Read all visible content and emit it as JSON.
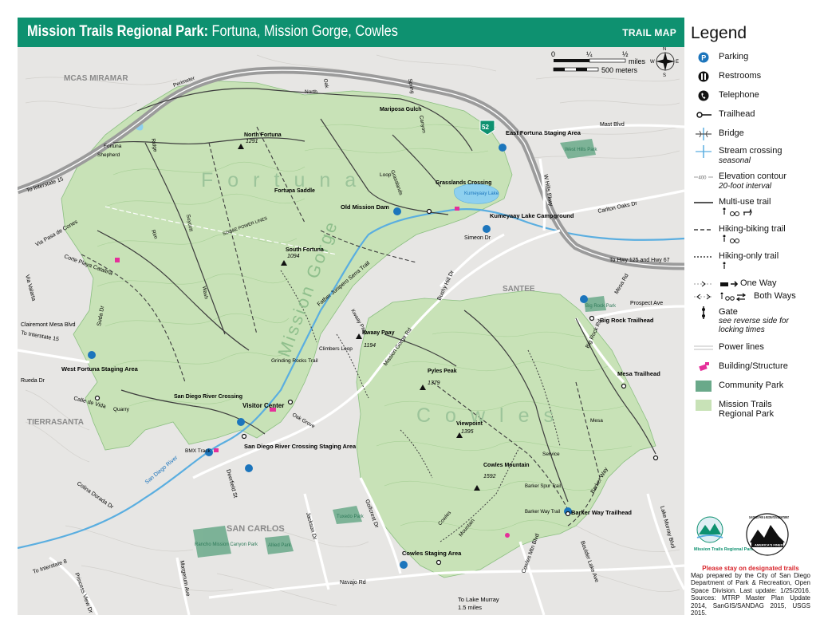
{
  "header": {
    "title_main": "Mission Trails Regional Park:",
    "title_sub": "Fortuna, Mission Gorge, Cowles",
    "map_type": "TRAIL MAP"
  },
  "scale_bar": {
    "miles_ticks": [
      "0",
      "¼",
      "½"
    ],
    "miles_label": "miles",
    "meters_label": "500 meters"
  },
  "compass": {
    "n": "N",
    "e": "E",
    "s": "S",
    "w": "W"
  },
  "areas": {
    "fortuna": "Fortuna",
    "mission_gorge": "Mission Gorge",
    "cowles": "Cowles"
  },
  "neighborhoods": {
    "mcas_miramar": "MCAS MIRAMAR",
    "santee": "SANTEE",
    "tierrasanta": "TIERRASANTA",
    "san_carlos": "SAN CARLOS"
  },
  "peaks": [
    {
      "name": "North Fortuna",
      "elev": "1291"
    },
    {
      "name": "South Fortuna",
      "elev": "1094"
    },
    {
      "name": "Kwaay Paay",
      "elev": "1194"
    },
    {
      "name": "Pyles Peak",
      "elev": "1379"
    },
    {
      "name": "Viewpoint",
      "elev": "1395"
    },
    {
      "name": "Cowles Mountain",
      "elev": "1592"
    }
  ],
  "places": {
    "east_fortuna": "East Fortuna Staging Area",
    "kumeyaay_campground": "Kumeyaay Lake Campground",
    "old_mission_dam": "Old Mission Dam",
    "grasslands": "Grasslands Crossing",
    "fortuna_saddle": "Fortuna Saddle",
    "big_rock": "Big Rock Trailhead",
    "mesa_trailhead": "Mesa Trailhead",
    "west_fortuna": "West Fortuna Staging Area",
    "visitor_center": "Visitor Center",
    "sdr_crossing": "San Diego River Crossing",
    "sdr_staging": "San Diego River Crossing Staging Area",
    "grinding_rocks": "Grinding Rocks Trail",
    "climbers_loop": "Climbers Loop",
    "bmx": "BMX Track",
    "barker_way": "Barker Way Trailhead",
    "cowles_staging": "Cowles Staging Area",
    "kumeyaay_lake": "Kumeyaay Lake",
    "barker_spur": "Barker Spur Trail",
    "mariposa": "Mariposa Gulch"
  },
  "parks": {
    "west_hills": "West Hills Park",
    "big_rock_park": "Big Rock Park",
    "tuxedo": "Tuxedo Park",
    "rancho": "Rancho Mission Canyon Park",
    "allied": "Allied Park"
  },
  "roads": {
    "to_i15_top": "To Interstate 15",
    "to_hwy125": "To Hwy 125 and Hwy 67",
    "to_i15_left": "To Interstate 15",
    "to_i8": "To Interstate 8",
    "to_lake_murray": "To Lake Murray",
    "lake_murray_dist": "1.5 miles",
    "mast_blvd": "Mast Blvd",
    "carlton_oaks": "Carlton Oaks Dr",
    "w_hills": "W Hills Pkwy",
    "prospect": "Prospect Ave",
    "mesa_rd": "Mesa Rd",
    "big_rock_rd": "Big Rock Rd",
    "bushy_hill": "Bushy Hill Dr",
    "simeon": "Simeon Dr",
    "father_junipero": "Father Junipero Serra Trail",
    "mission_gorge_rd": "Mission Gorge Rd",
    "golfcrest": "Golfcrest Dr",
    "jackson": "Jackson Dr",
    "navajo": "Navajo Rd",
    "cowles_mtn_blvd": "Cowles Mtn Blvd",
    "boulder_lake": "Boulder Lake Ave",
    "lake_murray_blvd": "Lake Murray Blvd",
    "barker_way_rd": "Barker Way",
    "princess_view": "Princess View Dr",
    "margerum": "Margerum Ave",
    "deerfield": "Deerfield St",
    "colina_dorada": "Colina Dorada Dr",
    "rueda": "Rueda Dr",
    "clairemont": "Clairemont Mesa Blvd",
    "via_valarta": "Via Valarta",
    "corte_playa": "Corte Playa Catalina",
    "via_pasa": "Via Pasa de Cones",
    "calle_de_vida": "Calle de Vida",
    "suda": "Suda Dr",
    "sdr_label": "San Diego River",
    "hwy52": "52",
    "power_lines": "SDG&E POWER LINES"
  },
  "trail_names": [
    "Perimeter",
    "Trail",
    "North",
    "Fortuna",
    "Shepherd",
    "Ridge",
    "Canyon",
    "Oak",
    "Spring",
    "Loop",
    "Wash",
    "Suycott",
    "Rim",
    "Quarry",
    "Oak Grove",
    "Visitor Center Loop",
    "Climbers",
    "Kwaay Paay",
    "Pyles",
    "Mesa",
    "Service",
    "Barker Way Trail",
    "Cowles",
    "Mountain",
    "Big Rock",
    "Flume",
    "Grasslands",
    "Shadow",
    "Creek"
  ],
  "legend": {
    "title": "Legend",
    "items": [
      {
        "key": "parking",
        "label": "Parking"
      },
      {
        "key": "restrooms",
        "label": "Restrooms"
      },
      {
        "key": "telephone",
        "label": "Telephone"
      },
      {
        "key": "trailhead",
        "label": "Trailhead"
      },
      {
        "key": "bridge",
        "label": "Bridge"
      },
      {
        "key": "stream",
        "label": "Stream crossing",
        "sub": "seasonal"
      },
      {
        "key": "contour",
        "label": "Elevation contour",
        "sub": "20-foot interval"
      },
      {
        "key": "multiuse",
        "label": "Multi-use trail"
      },
      {
        "key": "hikebike",
        "label": "Hiking-biking trail"
      },
      {
        "key": "hikeonly",
        "label": "Hiking-only trail"
      },
      {
        "key": "oneway",
        "label": "One Way"
      },
      {
        "key": "bothways",
        "label": "Both Ways"
      },
      {
        "key": "gate",
        "label": "Gate",
        "sub": "see reverse side for locking times"
      },
      {
        "key": "power",
        "label": "Power lines"
      },
      {
        "key": "building",
        "label": "Building/Structure"
      },
      {
        "key": "community",
        "label": "Community Park"
      },
      {
        "key": "mtrp",
        "label": "Mission Trails Regional Park"
      }
    ],
    "contour_value": "400"
  },
  "credits": {
    "logo_mtrp": "Mission Trails Regional Park",
    "logo_dept": "SAN DIEGO PARK & RECREATION DEPARTMENT",
    "logo_finest": "AMERICA'S FINEST",
    "warning": "Please stay on designated trails",
    "text": "Map prepared by the City of San Diego Department of Park & Recreation, Open Space Division. Last update: 1/25/2016. Sources: MTRP Master Plan Update 2014, SanGIS/SANDAG 2015, USGS 2015."
  },
  "colors": {
    "header": "#0e9170",
    "park_green": "#c8e2b7",
    "community_park": "#6aa98a",
    "water": "#5aaee0",
    "urban": "#e7e6e4",
    "freeway": "#9b9b9b",
    "building": "#e5309a",
    "parking": "#1c75bc"
  }
}
